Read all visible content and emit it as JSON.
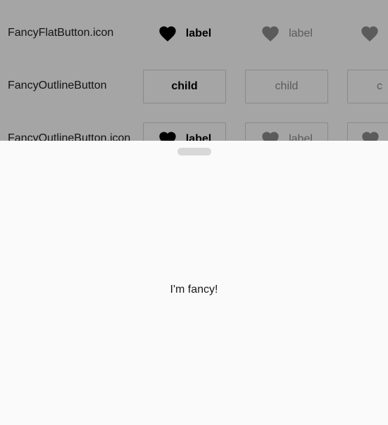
{
  "background_list": {
    "rows": [
      {
        "label": "FancyFlatButton.icon",
        "cells": [
          {
            "icon": "heart-icon",
            "text": "label"
          },
          {
            "icon": "heart-icon",
            "text": "label"
          },
          {
            "icon": "heart-icon",
            "text": ""
          }
        ]
      },
      {
        "label": "FancyOutlineButton",
        "cells": [
          {
            "text": "child"
          },
          {
            "text": "child"
          },
          {
            "text": "c"
          }
        ]
      },
      {
        "label": "FancyOutlineButton.icon",
        "cells": [
          {
            "icon": "heart-icon",
            "text": "label"
          },
          {
            "icon": "heart-icon",
            "text": "label"
          },
          {
            "icon": "heart-icon",
            "text": ""
          }
        ]
      }
    ]
  },
  "bottom_sheet": {
    "text": "I'm fancy!"
  },
  "colors": {
    "scrim": "#000000",
    "enabled": "#000000",
    "disabled": "#8a8a8a",
    "sheet": "#fafafa",
    "handle": "#d8d8d8"
  }
}
